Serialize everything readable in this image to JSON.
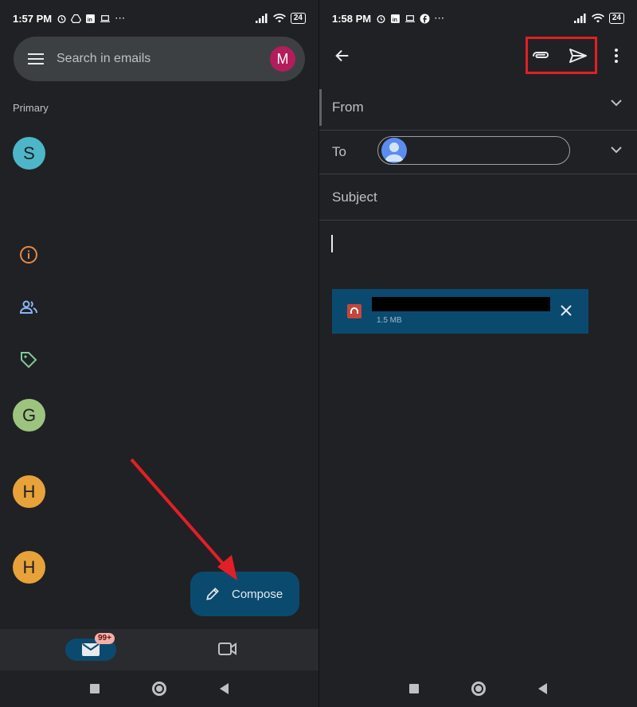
{
  "left": {
    "status": {
      "time": "1:57 PM",
      "battery": "24"
    },
    "search": {
      "placeholder": "Search in emails",
      "account_initial": "M"
    },
    "section_label": "Primary",
    "avatars": [
      {
        "initial": "S",
        "color": "#4db6c8"
      },
      {
        "initial": "G",
        "color": "#9dc47f"
      },
      {
        "initial": "H",
        "color": "#e8a23a"
      },
      {
        "initial": "H",
        "color": "#e8a23a"
      }
    ],
    "category_icons": [
      "info-icon",
      "people-icon",
      "tag-icon"
    ],
    "compose_label": "Compose",
    "mail_badge": "99+"
  },
  "right": {
    "status": {
      "time": "1:58 PM",
      "battery": "24"
    },
    "fields": {
      "from_label": "From",
      "to_label": "To",
      "subject_placeholder": "Subject"
    },
    "attachment": {
      "size": "1.5 MB"
    }
  },
  "colors": {
    "background": "#202124",
    "accent_blue": "#0b4a6f",
    "highlight_red": "#e21f26"
  }
}
